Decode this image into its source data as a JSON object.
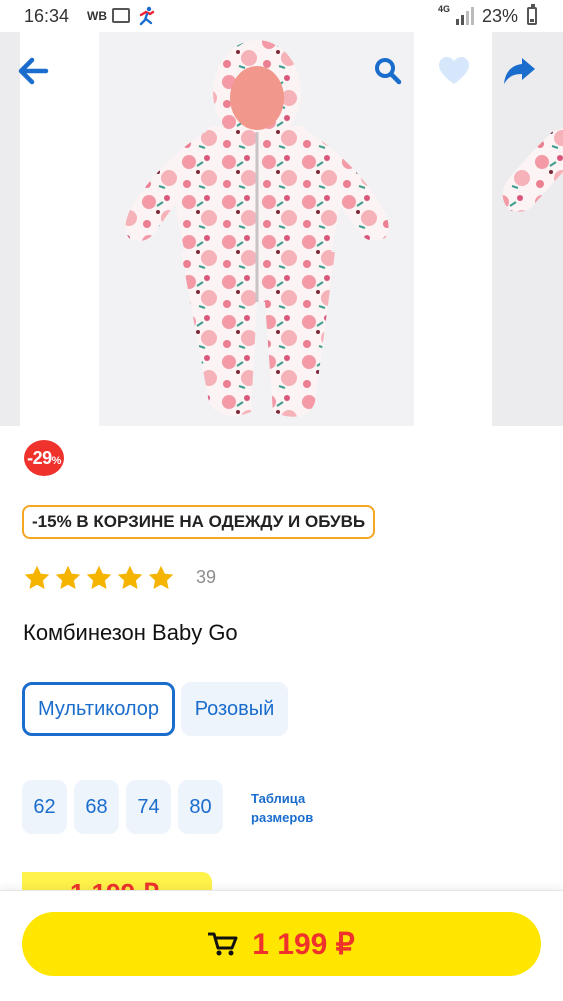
{
  "status_bar": {
    "time": "16:34",
    "carrier_badge": "WB",
    "network": "4G",
    "battery": "23%"
  },
  "gallery": {
    "main_image": "pink-floral-baby-snowsuit-photo"
  },
  "header": {
    "back_icon": "arrow-left-icon",
    "search_icon": "search-icon",
    "favorite_icon": "heart-icon",
    "share_icon": "share-icon"
  },
  "badge": {
    "discount_value": "-29",
    "discount_suffix": "%"
  },
  "promo": {
    "text": "-15% В КОРЗИНЕ НА ОДЕЖДУ И ОБУВЬ"
  },
  "rating": {
    "stars": 5,
    "count": "39"
  },
  "product": {
    "title": "Комбинезон Baby Go"
  },
  "colors": {
    "options": [
      "Мультиколор",
      "Розовый"
    ],
    "selected": "Мультиколор"
  },
  "sizes": {
    "options": [
      "62",
      "68",
      "74",
      "80"
    ],
    "size_table_line1": "Таблица",
    "size_table_line2": "размеров"
  },
  "price_block": {
    "old_price_partial": "1 199 ₽"
  },
  "cart_button": {
    "price": "1 199 ₽"
  },
  "theme": {
    "accent": "#1a6dcc",
    "cta_yellow": "#ffe600",
    "price_red": "#f0322d",
    "star": "#f5b400",
    "promo_border": "#f5a623"
  }
}
